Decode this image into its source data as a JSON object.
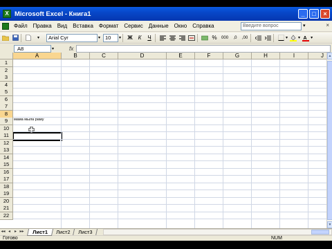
{
  "window": {
    "title": "Microsoft Excel - Книга1",
    "icon": "excel-icon",
    "controls": [
      "_",
      "□",
      "×"
    ]
  },
  "menu": {
    "items": [
      "Файл",
      "Правка",
      "Вид",
      "Вставка",
      "Формат",
      "Сервис",
      "Данные",
      "Окно",
      "Справка"
    ],
    "help_placeholder": "Введите вопрос",
    "doc_close": "×"
  },
  "toolbar": {
    "font_name": "Arial Cyr",
    "font_size": "10",
    "bold": "Ж",
    "italic": "К",
    "underline": "Ч",
    "percent": "%",
    "thousands": "000"
  },
  "formula_bar": {
    "name_box": "A8",
    "fx": "fx",
    "formula": ""
  },
  "grid": {
    "columns": [
      "A",
      "B",
      "C",
      "D",
      "E",
      "F",
      "G",
      "H",
      "I",
      "J"
    ],
    "rows": [
      "1",
      "2",
      "3",
      "4",
      "5",
      "6",
      "7",
      "8",
      "9",
      "10",
      "11",
      "12",
      "13",
      "14",
      "15",
      "16",
      "17",
      "18",
      "19",
      "20",
      "21",
      "22"
    ],
    "active_cell": "A8",
    "cells": {
      "A6": "мама мыла раму"
    }
  },
  "sheets": {
    "tabs": [
      "Лист1",
      "Лист2",
      "Лист3"
    ],
    "active": "Лист1",
    "nav": [
      "◂◂",
      "◂",
      "▸",
      "▸▸"
    ]
  },
  "status": {
    "left": "Готово",
    "num": "NUM"
  },
  "colors": {
    "title_bar": "#0747c8",
    "active_header": "#f9d690",
    "gridline": "#d0d7e5"
  }
}
